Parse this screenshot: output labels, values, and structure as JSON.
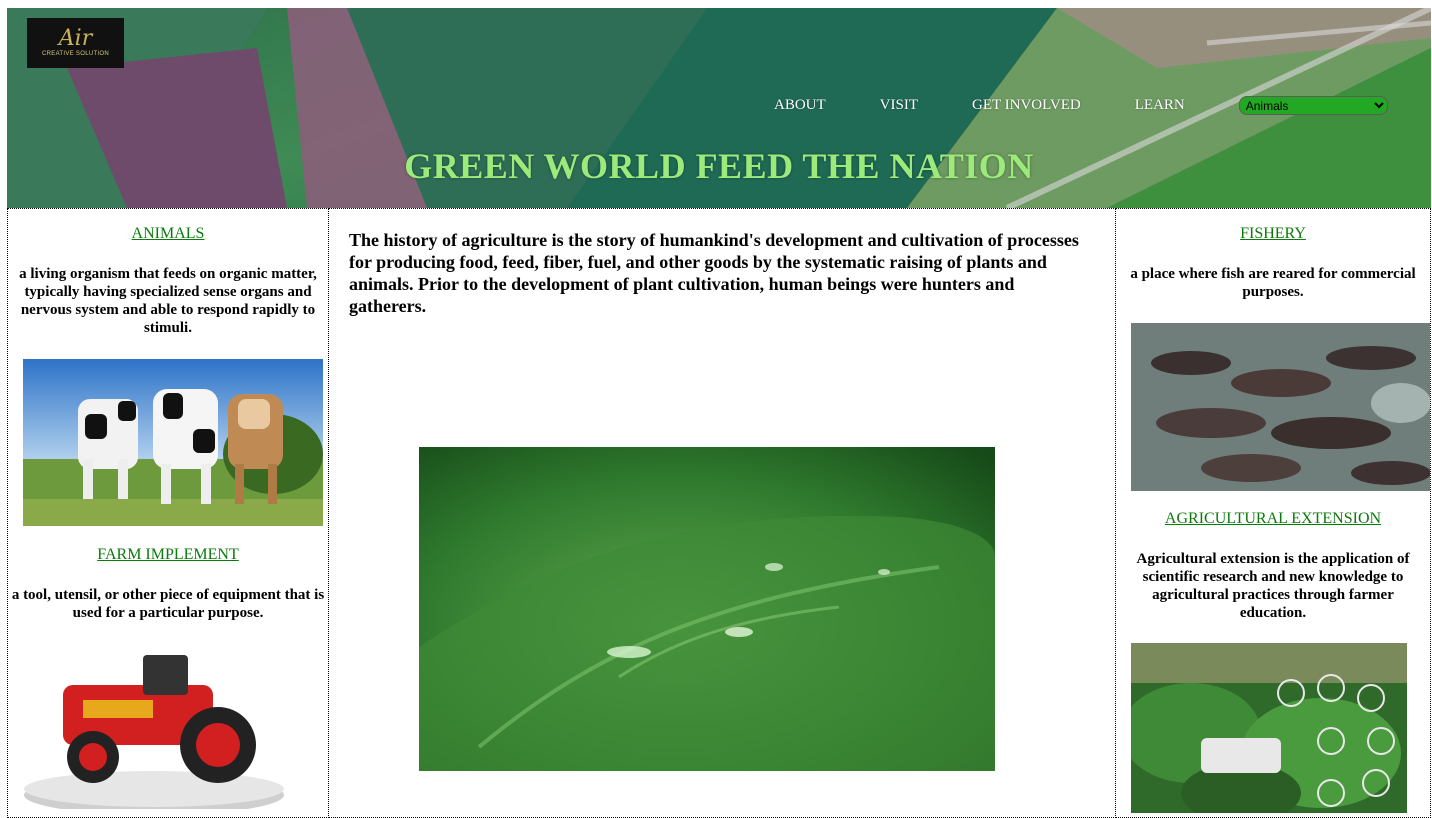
{
  "header": {
    "logo": {
      "mark": "Air",
      "subtitle": "CREATIVE SOLUTION"
    },
    "nav": [
      {
        "label": "ABOUT"
      },
      {
        "label": "VISIT"
      },
      {
        "label": "GET INVOLVED"
      },
      {
        "label": "LEARN"
      }
    ],
    "category_select": {
      "selected": "Animals"
    },
    "title": "GREEN WORLD FEED THE NATION"
  },
  "left": {
    "animals": {
      "link": "ANIMALS",
      "description": "a living organism that feeds on organic matter, typically having specialized sense organs and nervous system and able to respond rapidly to stimuli."
    },
    "farm_implement": {
      "link": "FARM IMPLEMENT",
      "description": "a tool, utensil, or other piece of equipment that is used for a particular purpose."
    }
  },
  "main": {
    "intro": "The history of agriculture is the story of humankind's development and cultivation of processes for producing food, feed, fiber, fuel, and other goods by the systematic raising of plants and animals. Prior to the development of plant cultivation, human beings were hunters and gatherers."
  },
  "right": {
    "fishery": {
      "link": "FISHERY",
      "description": "a place where fish are reared for commercial purposes."
    },
    "extension": {
      "link": "AGRICULTURAL EXTENSION",
      "description": "Agricultural extension is the application of scientific research and new knowledge to agricultural practices through farmer education."
    }
  },
  "colors": {
    "link": "#0a7a0a",
    "title": "#9bea7a",
    "select": "#22a822"
  }
}
